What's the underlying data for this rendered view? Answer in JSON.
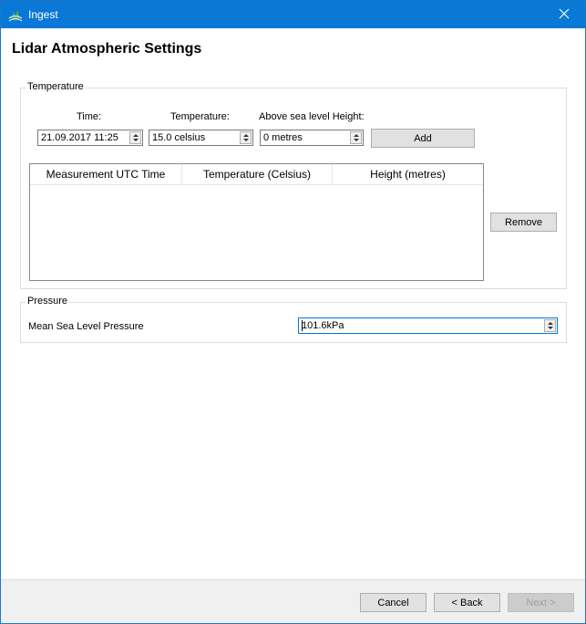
{
  "window": {
    "title": "Ingest",
    "app_icon": "ingest-app-icon",
    "close_icon": "close-icon",
    "accent": "#0a78d7"
  },
  "page": {
    "title": "Lidar Atmospheric Settings"
  },
  "temperature_group": {
    "label": "Temperature",
    "time_label": "Time:",
    "time_value": "21.09.2017 11:25",
    "temperature_label": "Temperature:",
    "temperature_value": "15.0 celsius",
    "height_label": "Above sea level Height:",
    "height_value": "0 metres",
    "add_label": "Add",
    "remove_label": "Remove",
    "table": {
      "columns": [
        "Measurement UTC Time",
        "Temperature (Celsius)",
        "Height (metres)"
      ],
      "rows": []
    }
  },
  "pressure_group": {
    "label": "Pressure",
    "field_label": "Mean Sea Level Pressure",
    "value": "101.6kPa"
  },
  "footer": {
    "cancel_label": "Cancel",
    "back_label": "< Back",
    "next_label": "Next >",
    "next_disabled": true
  }
}
